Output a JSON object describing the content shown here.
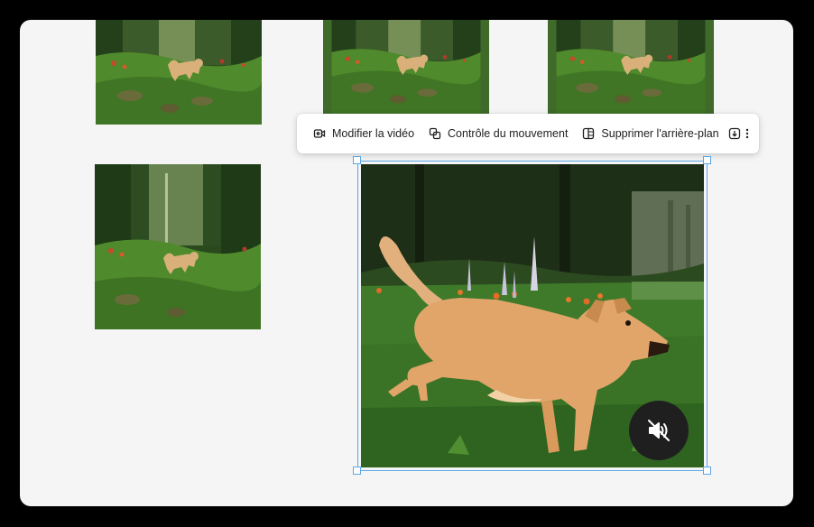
{
  "toolbar": {
    "edit_video_label": "Modifier la vidéo",
    "motion_control_label": "Contrôle du mouvement",
    "remove_background_label": "Supprimer l'arrière-plan",
    "download_icon": "download-icon",
    "more_icon": "more-vert-icon"
  },
  "gallery": {
    "thumbnails": [
      {
        "name": "dog-in-forest-thumbnail-1"
      },
      {
        "name": "dog-in-forest-thumbnail-2"
      },
      {
        "name": "dog-in-forest-thumbnail-3"
      },
      {
        "name": "dog-in-forest-thumbnail-4"
      }
    ]
  },
  "player": {
    "mute_icon": "volume-off-icon",
    "selection_color": "#5aa7e6"
  }
}
